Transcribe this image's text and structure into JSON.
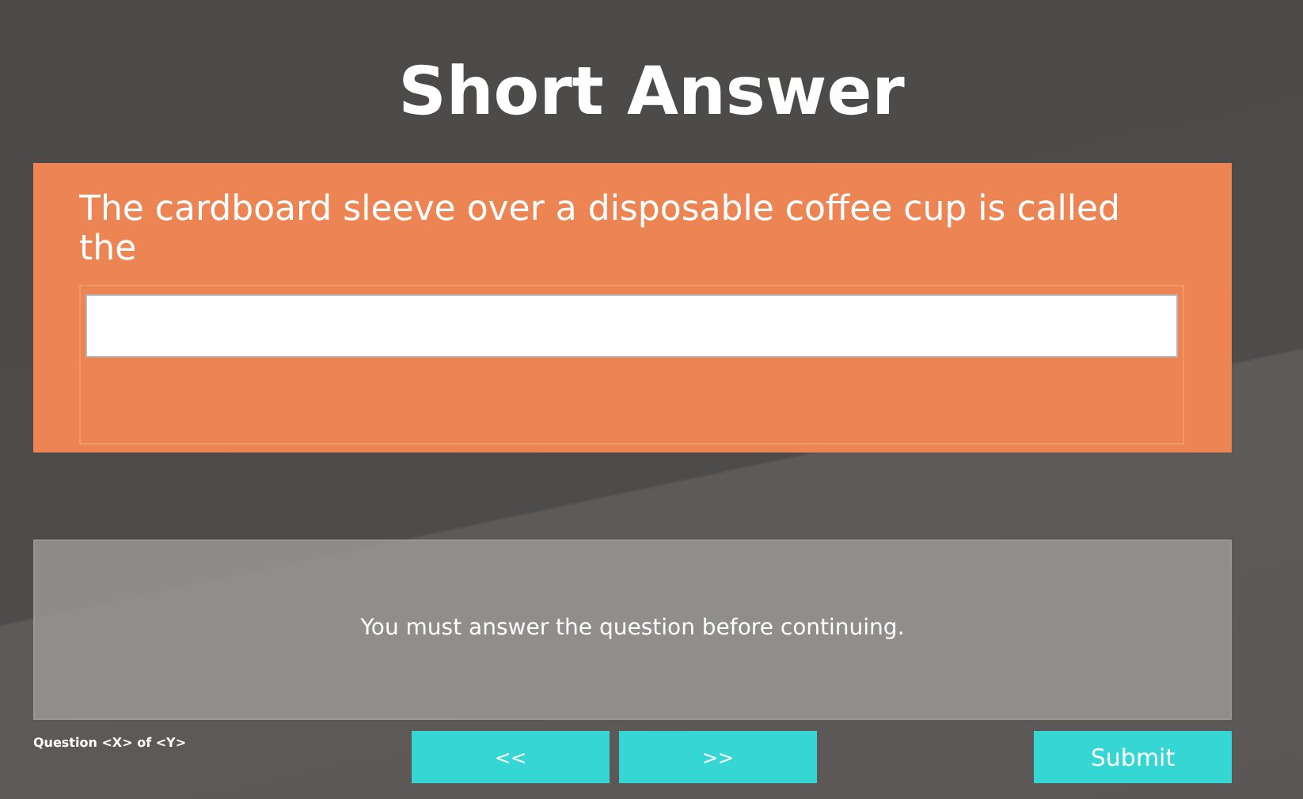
{
  "title": "Short Answer",
  "question": {
    "prompt": "The cardboard sleeve over a disposable coffee cup is called the"
  },
  "feedback": {
    "message": "You must answer the question before continuing."
  },
  "footer": {
    "progress": "Question <X> of <Y>",
    "buttons": [
      {
        "kind": "prev",
        "label": "<<"
      },
      {
        "kind": "next",
        "label": ">>"
      },
      {
        "kind": "submit",
        "label": "Submit"
      }
    ]
  }
}
